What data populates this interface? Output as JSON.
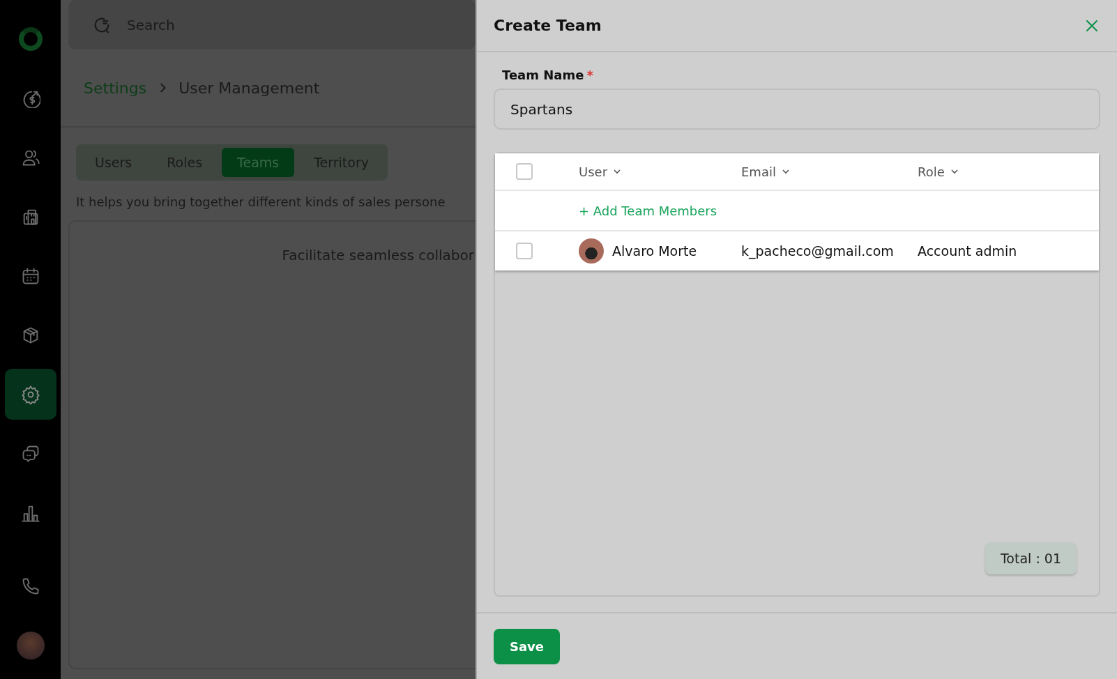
{
  "sidebar": {
    "items": [
      {
        "kind": "logo"
      },
      {
        "kind": "dollar",
        "selected": false
      },
      {
        "kind": "users",
        "selected": false
      },
      {
        "kind": "building",
        "selected": false
      },
      {
        "kind": "calendar",
        "selected": false
      },
      {
        "kind": "box",
        "selected": false
      },
      {
        "kind": "gear",
        "selected": true
      },
      {
        "kind": "chat",
        "selected": false
      },
      {
        "kind": "chart",
        "selected": false
      },
      {
        "kind": "spacer"
      },
      {
        "kind": "phone",
        "selected": false
      },
      {
        "kind": "avatar"
      }
    ]
  },
  "search": {
    "placeholder": "Search"
  },
  "breadcrumb": [
    "Settings",
    "User Management"
  ],
  "tabs": [
    {
      "label": "Users",
      "selected": false
    },
    {
      "label": "Roles",
      "selected": false
    },
    {
      "label": "Teams",
      "selected": true
    },
    {
      "label": "Territory",
      "selected": false
    }
  ],
  "description": "It helps you bring together different kinds of sales persone",
  "card": {
    "heading": "Facilitate seamless collabor"
  },
  "panel": {
    "title": "Create Team",
    "team_name": {
      "label": "Team Name",
      "required_mark": "*",
      "value": "Spartans"
    },
    "table": {
      "select_all": {
        "checked": false
      },
      "columns": [
        "User",
        "Email",
        "Role"
      ],
      "add_link": "+ Add Team Members",
      "rows": [
        {
          "checked": false,
          "user": "Alvaro Morte",
          "email": "k_pacheco@gmail.com",
          "role": "Account admin"
        }
      ]
    },
    "total": "Total : 01",
    "save": "Save"
  }
}
